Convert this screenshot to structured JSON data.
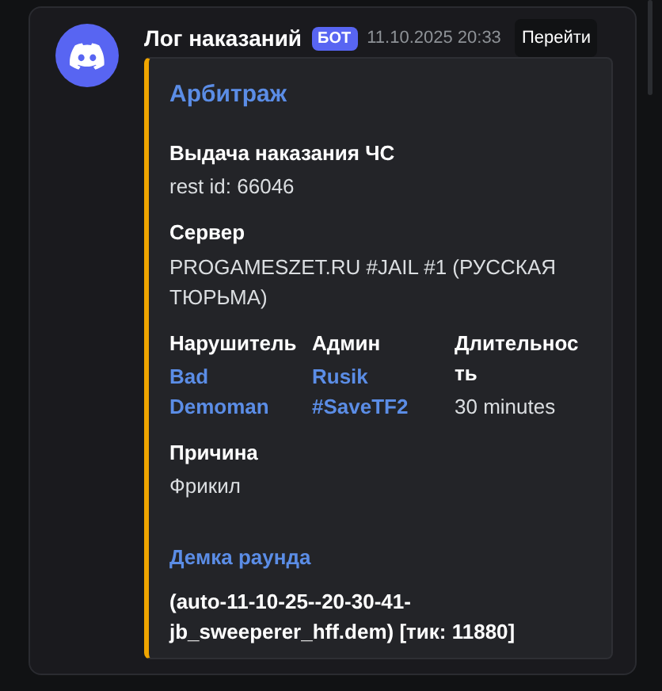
{
  "message": {
    "author": "Лог наказаний",
    "badge": "БОТ",
    "timestamp": "11.10.2025 20:33",
    "jump_button": "Перейти"
  },
  "embed": {
    "title": "Арбитраж",
    "color": "#f0a500",
    "fields": [
      {
        "kind": "block",
        "name": "Выдача наказания ЧС",
        "value": "rest id: 66046"
      },
      {
        "kind": "block",
        "name": "Сервер",
        "value": "PROGAMESZET.RU #JAIL #1 (РУССКАЯ ТЮРЬМА)"
      },
      {
        "kind": "inline_mention",
        "name": "Нарушитель",
        "value": "Bad Demoman"
      },
      {
        "kind": "inline_mention",
        "name": "Админ",
        "value": "Rusik #SaveTF2"
      },
      {
        "kind": "inline_text",
        "name": "Длительность",
        "value": "30 minutes"
      },
      {
        "kind": "block",
        "name": "Причина",
        "value": "Фрикил"
      },
      {
        "kind": "link",
        "name": "Демка раунда",
        "value": "(auto-11-10-25--20-30-41-jb_sweeperer_hff.dem) [тик: 11880]"
      }
    ]
  }
}
